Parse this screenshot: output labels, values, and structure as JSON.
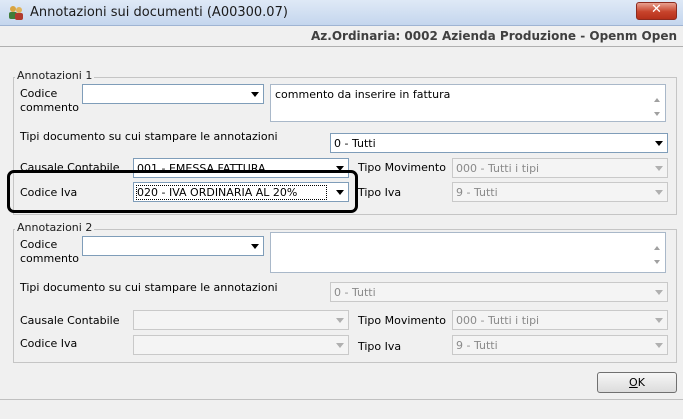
{
  "window": {
    "title": "Annotazioni sui documenti (A00300.07)",
    "close_label": "✕"
  },
  "company_line": "Az.Ordinaria: 0002 Azienda Produzione - Openm Open",
  "group1": {
    "title": "Annotazioni 1",
    "codice_label_1": "Codice",
    "codice_label_2": "commento",
    "codice_value": "",
    "comment_text": "commento da inserire in fattura",
    "tipi_label": "Tipi documento su cui stampare le annotazioni",
    "tipi_value": "0 - Tutti",
    "causale_label": "Causale Contabile",
    "causale_value": "001 - EMESSA FATTURA",
    "tipo_movimento_label": "Tipo Movimento",
    "tipo_movimento_value": "000 - Tutti i tipi",
    "codice_iva_label": "Codice Iva",
    "codice_iva_value": "020 - IVA ORDINARIA AL 20%",
    "tipo_iva_label": "Tipo Iva",
    "tipo_iva_value": "9 - Tutti"
  },
  "group2": {
    "title": "Annotazioni 2",
    "codice_label_1": "Codice",
    "codice_label_2": "commento",
    "codice_value": "",
    "comment_text": "",
    "tipi_label": "Tipi documento su cui stampare le annotazioni",
    "tipi_value": "0 - Tutti",
    "causale_label": "Causale Contabile",
    "causale_value": "",
    "tipo_movimento_label": "Tipo Movimento",
    "tipo_movimento_value": "000 - Tutti i tipi",
    "codice_iva_label": "Codice Iva",
    "codice_iva_value": "",
    "tipo_iva_label": "Tipo Iva",
    "tipo_iva_value": "9 - Tutti"
  },
  "ok_button": {
    "underlined": "O",
    "rest": "K"
  },
  "icons": {
    "app": "users-notes-icon",
    "close": "close-icon"
  }
}
